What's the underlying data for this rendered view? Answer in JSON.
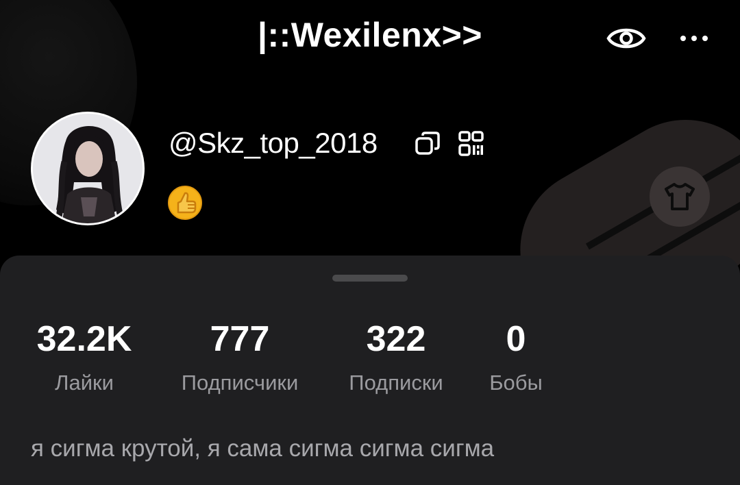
{
  "header": {
    "title": "|::Wexilenx>>",
    "eye_icon": "eye-icon",
    "more_icon": "more-horizontal-icon"
  },
  "profile": {
    "username": "@Skz_top_2018",
    "copy_icon": "copy-icon",
    "qr_icon": "qr-code-icon",
    "badge_icon": "thumbs-up-emoji-icon",
    "outfit_icon": "t-shirt-icon"
  },
  "stats": [
    {
      "value": "32.2K",
      "label": "Лайки"
    },
    {
      "value": "777",
      "label": "Подписчики"
    },
    {
      "value": "322",
      "label": "Подписки"
    },
    {
      "value": "0",
      "label": "Бобы"
    }
  ],
  "bio": "я сигма крутой, я сама сигма сигма сигма",
  "colors": {
    "background": "#000000",
    "sheet": "#1f1f21",
    "primary_text": "#ffffff",
    "secondary_text": "#9b9b9f",
    "badge": "#f5b21a"
  }
}
